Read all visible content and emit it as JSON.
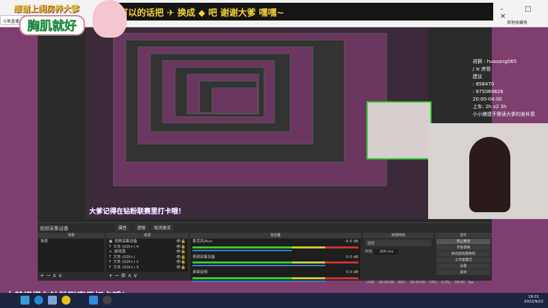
{
  "browser": {
    "tab_title": "斗鱼直播",
    "favorites": "其他收藏夹",
    "window_controls": "– □ ✕"
  },
  "overlay": {
    "thanks_text": "感谢上闺房养大爹",
    "banner_text": "可以的话把 ✈ 换成 ◆ 吧    谢谢大爹 嘿嘿~",
    "chest_text": "胸肌就好",
    "checkin_text": "大爹记得在钻粉联赛里打卡哦！",
    "info_lines": [
      "进群 : huasang065",
      "/ ≡ 房管",
      "建议",
      ": 858470",
      ": 875069826",
      "20:00-04:00",
      "上车: 2h  x2 3h",
      "小小猪建不需读大爹的发补质"
    ]
  },
  "obs": {
    "source_label": "视频采集设备",
    "properties": "属性",
    "filters": "滤镜",
    "deactivate": "取消激活",
    "scenes": {
      "header": "场景",
      "items": [
        "场景"
      ]
    },
    "sources": {
      "header": "来源",
      "items": [
        {
          "icon": "camera-icon",
          "label": "视频采集设备"
        },
        {
          "icon": "text-icon",
          "label": "文本 (GDI+) 4"
        },
        {
          "icon": "game-icon",
          "label": "游戏源"
        },
        {
          "icon": "text-icon",
          "label": "文本 (GDI+)"
        },
        {
          "icon": "text-icon",
          "label": "文本 (GDI+) 2"
        },
        {
          "icon": "text-icon",
          "label": "文本 (GDI+) 3"
        }
      ]
    },
    "mixer": {
      "header": "混音器",
      "channels": [
        {
          "name": "麦克风/Aux",
          "db": "-6.6 dB",
          "volume": 0.75
        },
        {
          "name": "视频采集设备",
          "db": "0.0 dB",
          "volume": 1.0
        },
        {
          "name": "桌面音频",
          "db": "0.0 dB",
          "volume": 1.0
        }
      ]
    },
    "transitions": {
      "header": "转场特效",
      "selected": "淡化",
      "duration_label": "时长",
      "duration": "300 ms"
    },
    "controls": {
      "header": "控件",
      "buttons": [
        "停止推流",
        "开始录制",
        "启动虚拟摄像机",
        "工作室模式",
        "设置",
        "退出"
      ]
    },
    "status": {
      "live": "LIVE: 00:00:00",
      "rec": "REC: 00:00:00",
      "cpu": "CPU: 0.0%, 59.94 fps"
    }
  },
  "taskbar": {
    "time": "19:31",
    "date": "2022/9/22"
  }
}
